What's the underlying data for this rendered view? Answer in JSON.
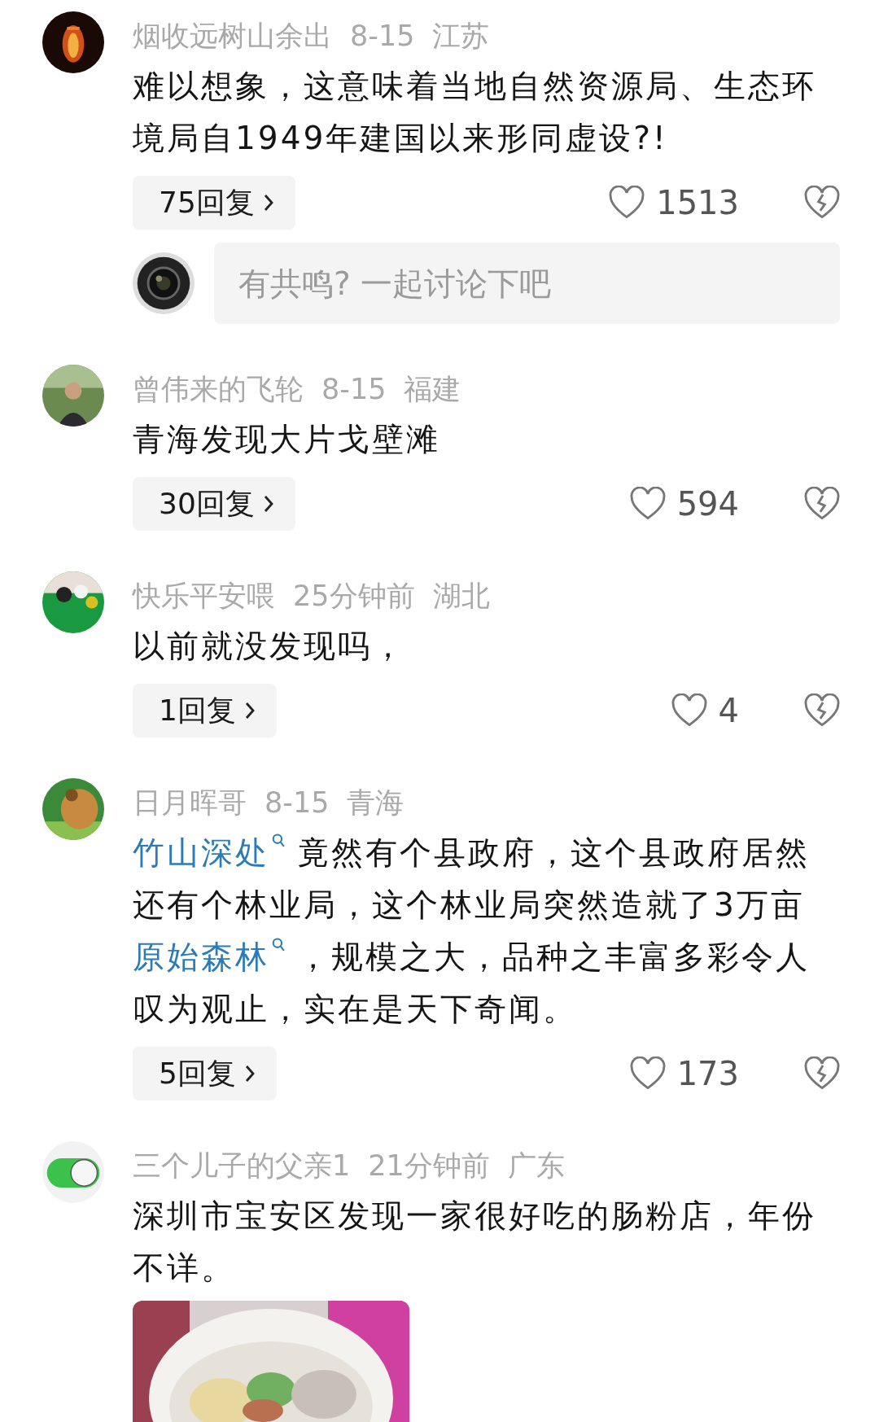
{
  "comments": [
    {
      "user": "烟收远树山余出",
      "date": "8-15",
      "region": "江苏",
      "body": [
        {
          "kind": "text",
          "text": "难以想象，这意味着当地自然资源局、生态环境局自1949年建国以来形同虚设?!"
        }
      ],
      "replies": "75回复",
      "likes": "1513",
      "input": {
        "placeholder": "有共鸣? 一起讨论下吧"
      }
    },
    {
      "user": "曾伟来的飞轮",
      "date": "8-15",
      "region": "福建",
      "body": [
        {
          "kind": "text",
          "text": "青海发现大片戈壁滩"
        }
      ],
      "replies": "30回复",
      "likes": "594"
    },
    {
      "user": "快乐平安喂",
      "date": "25分钟前",
      "region": "湖北",
      "body": [
        {
          "kind": "text",
          "text": "以前就没发现吗，"
        }
      ],
      "replies": "1回复",
      "likes": "4"
    },
    {
      "user": "日月晖哥",
      "date": "8-15",
      "region": "青海",
      "body": [
        {
          "kind": "link",
          "text": "竹山深处"
        },
        {
          "kind": "text",
          "text": " 竟然有个县政府，这个县政府居然还有个林业局，这个林业局突然造就了3万亩"
        },
        {
          "kind": "link",
          "text": "原始森林"
        },
        {
          "kind": "text",
          "text": " ，规模之大，品种之丰富多彩令人叹为观止，实在是天下奇闻。"
        }
      ],
      "replies": "5回复",
      "likes": "173"
    },
    {
      "user": "三个儿子的父亲1",
      "date": "21分钟前",
      "region": "广东",
      "body": [
        {
          "kind": "text",
          "text": "深圳市宝安区发现一家很好吃的肠粉店，年份不详。"
        }
      ]
    }
  ]
}
